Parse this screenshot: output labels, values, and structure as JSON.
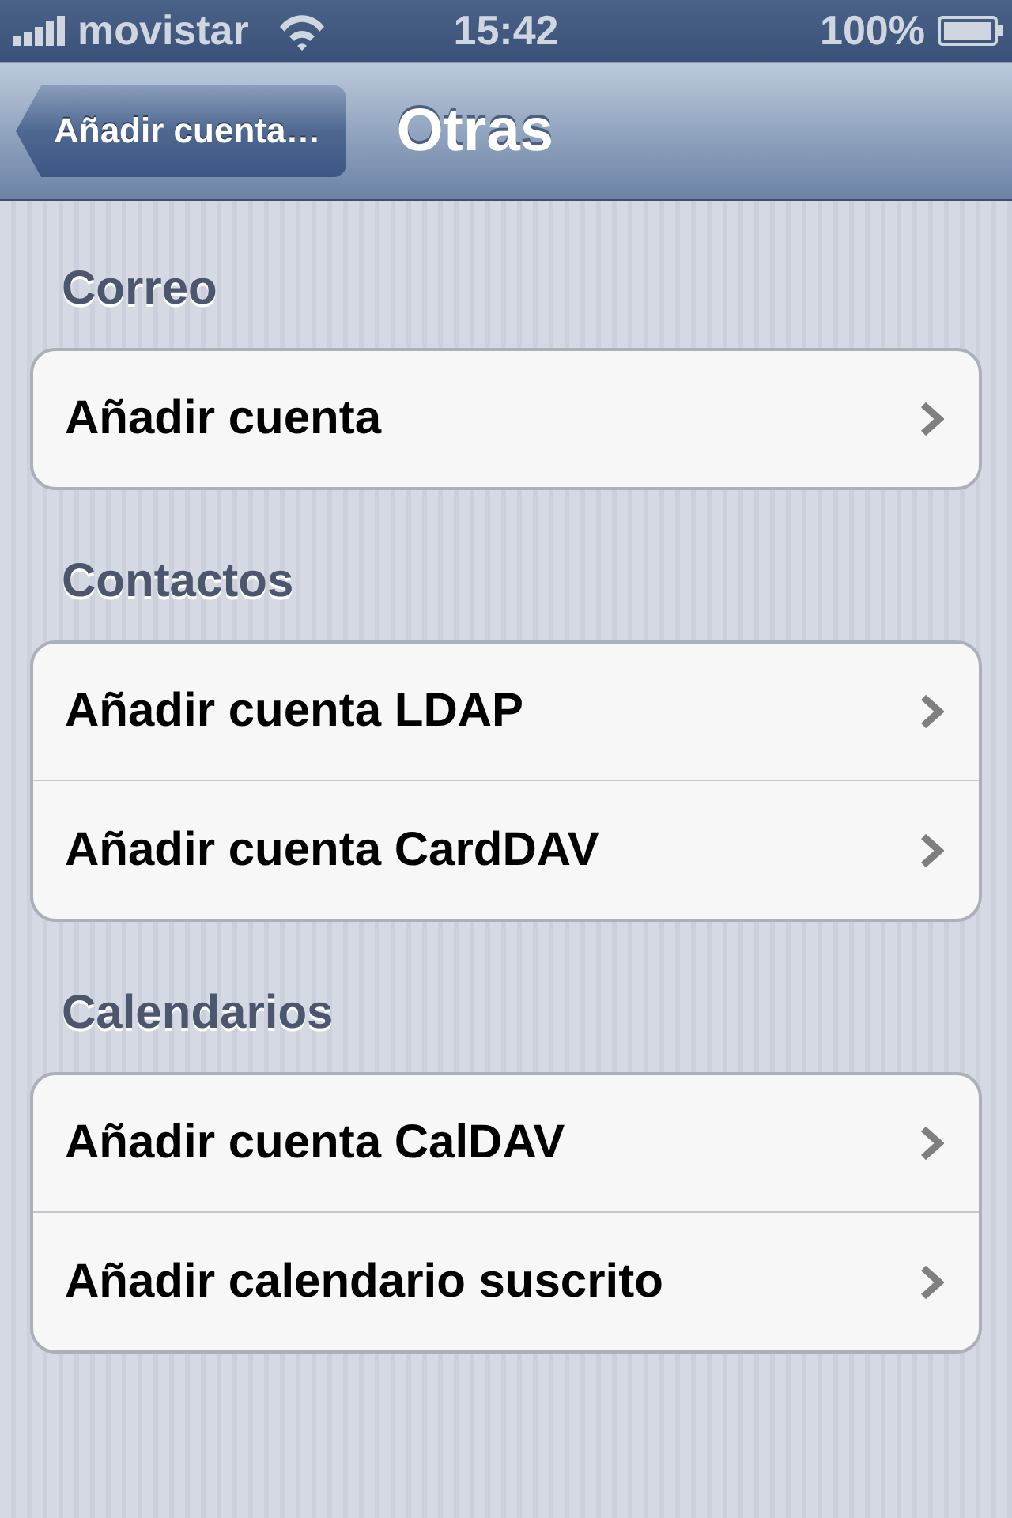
{
  "status_bar": {
    "carrier": "movistar",
    "time": "15:42",
    "battery": "100%"
  },
  "nav_bar": {
    "back_button": "Añadir cuenta…",
    "title": "Otras"
  },
  "sections": [
    {
      "header": "Correo",
      "rows": [
        {
          "label": "Añadir cuenta"
        }
      ]
    },
    {
      "header": "Contactos",
      "rows": [
        {
          "label": "Añadir cuenta LDAP"
        },
        {
          "label": "Añadir cuenta CardDAV"
        }
      ]
    },
    {
      "header": "Calendarios",
      "rows": [
        {
          "label": "Añadir cuenta CalDAV"
        },
        {
          "label": "Añadir calendario suscrito"
        }
      ]
    }
  ]
}
